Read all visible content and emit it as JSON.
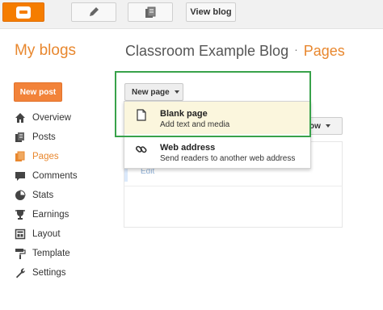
{
  "toolbar": {
    "blogger_icon": "blogger-logo-icon",
    "pencil_icon": "pencil-icon",
    "pages_icon": "pages-icon",
    "view_blog": "View blog"
  },
  "header": {
    "my_blogs": "My blogs",
    "blog_name": "Classroom Example Blog",
    "separator": "·",
    "section": "Pages"
  },
  "sidebar": {
    "new_post": "New post",
    "items": [
      {
        "label": "Overview",
        "icon": "home-icon"
      },
      {
        "label": "Posts",
        "icon": "posts-icon"
      },
      {
        "label": "Pages",
        "icon": "pages-icon"
      },
      {
        "label": "Comments",
        "icon": "comment-icon"
      },
      {
        "label": "Stats",
        "icon": "pie-chart-icon"
      },
      {
        "label": "Earnings",
        "icon": "trophy-icon"
      },
      {
        "label": "Layout",
        "icon": "layout-icon"
      },
      {
        "label": "Template",
        "icon": "paint-roller-icon"
      },
      {
        "label": "Settings",
        "icon": "wrench-icon"
      }
    ],
    "active": "Pages"
  },
  "main": {
    "new_page": "New page",
    "show_button": "ow",
    "edit_link": "Edit"
  },
  "menu": {
    "items": [
      {
        "title": "Blank page",
        "subtitle": "Add text and media",
        "icon": "blank-page-icon"
      },
      {
        "title": "Web address",
        "subtitle": "Send readers to another web address",
        "icon": "link-icon"
      }
    ]
  },
  "colors": {
    "accent": "#e8872e",
    "highlight_box": "#38a24a",
    "menu_highlight": "#fbf6dd"
  }
}
